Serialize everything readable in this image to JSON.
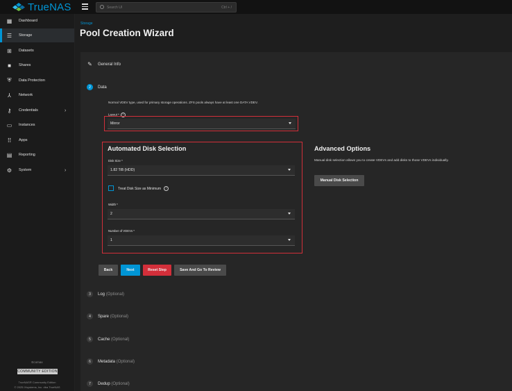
{
  "app": {
    "name": "TrueNAS"
  },
  "search": {
    "placeholder": "Search UI",
    "shortcut": "Ctrl + /"
  },
  "sidebar": {
    "items": [
      {
        "label": "Dashboard",
        "icon": "dashboard-icon"
      },
      {
        "label": "Storage",
        "icon": "storage-icon"
      },
      {
        "label": "Datasets",
        "icon": "datasets-icon"
      },
      {
        "label": "Shares",
        "icon": "shares-icon"
      },
      {
        "label": "Data Protection",
        "icon": "shield-icon"
      },
      {
        "label": "Network",
        "icon": "network-icon"
      },
      {
        "label": "Credentials",
        "icon": "key-icon"
      },
      {
        "label": "Instances",
        "icon": "monitor-icon"
      },
      {
        "label": "Apps",
        "icon": "apps-grid-icon"
      },
      {
        "label": "Reporting",
        "icon": "chart-icon"
      },
      {
        "label": "System",
        "icon": "gear-icon"
      }
    ],
    "footer": {
      "label": "Ecomax",
      "badge": "COMMUNITY EDITION",
      "line1": "TrueNAS® Community Edition",
      "line2": "© 2025 iXsystems, Inc. dba TrueNAS"
    }
  },
  "page": {
    "breadcrumb": "Storage",
    "title": "Pool Creation Wizard"
  },
  "steps": {
    "general": "General Info",
    "data": {
      "number": "2",
      "label": "Data"
    },
    "log": {
      "number": "3",
      "label": "Log",
      "optional": "(Optional)"
    },
    "spare": {
      "number": "4",
      "label": "Spare",
      "optional": "(Optional)"
    },
    "cache": {
      "number": "5",
      "label": "Cache",
      "optional": "(Optional)"
    },
    "metadata": {
      "number": "6",
      "label": "Metadata",
      "optional": "(Optional)"
    },
    "dedup": {
      "number": "7",
      "label": "Dedup",
      "optional": "(Optional)"
    }
  },
  "data_step": {
    "description": "Normal VDEV type, used for primary storage operations. ZFS pools always have at least one DATA VDEV.",
    "layout": {
      "label": "Layout *",
      "value": "Mirror"
    },
    "automated": {
      "title": "Automated Disk Selection",
      "disk_size": {
        "label": "Disk Size *",
        "value": "1.82 TiB (HDD)"
      },
      "treat_min": "Treat Disk Size as Minimum",
      "width": {
        "label": "Width *",
        "value": "2"
      },
      "vdevs": {
        "label": "Number of VDEVs *",
        "value": "1"
      }
    },
    "advanced": {
      "title": "Advanced Options",
      "description": "Manual disk selection allows you to create VDEVs and add disks to those VDEVs individually.",
      "button": "Manual Disk Selection"
    }
  },
  "buttons": {
    "back": "Back",
    "next": "Next",
    "reset": "Reset Step",
    "review": "Save And Go To Review"
  },
  "colors": {
    "accent": "#0095d5",
    "danger": "#d32f3a",
    "highlight": "#d32f3a"
  }
}
